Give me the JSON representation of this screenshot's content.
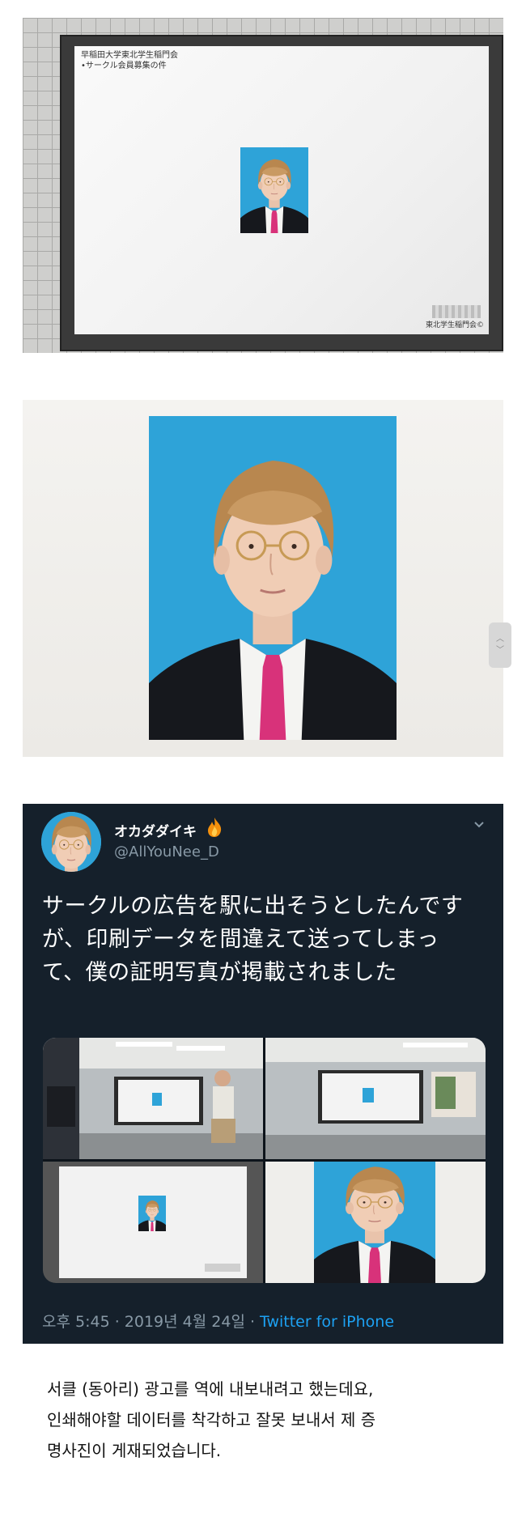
{
  "board": {
    "header_line1": "早稲田大学東北学生稲門会",
    "header_line2": "•サークル会員募集の件",
    "signature": "東北学生稲門会©"
  },
  "tweet": {
    "display_name": "オカダダイキ",
    "handle": "@AllYouNee_D",
    "text": "サークルの広告を駅に出そうとしたんですが、印刷データを間違えて送ってしまって、僕の証明写真が掲載されました",
    "timestamp": "오후 5:45 · 2019년 4월 24일",
    "source": "Twitter for iPhone",
    "icons": [
      "flame-emoji",
      "chevron-down-icon"
    ]
  },
  "caption": {
    "text": "서클 (동아리) 광고를 역에 내보내려고 했는데요,\n인쇄해야할 데이터를 착각하고 잘못 보내서 제 증\n명사진이 게재되었습니다."
  },
  "colors": {
    "tweet_bg": "#15202b",
    "tweet_secondary": "#8899a6",
    "link_blue": "#1da1f2",
    "photo_bg_blue": "#2ea3d8"
  }
}
